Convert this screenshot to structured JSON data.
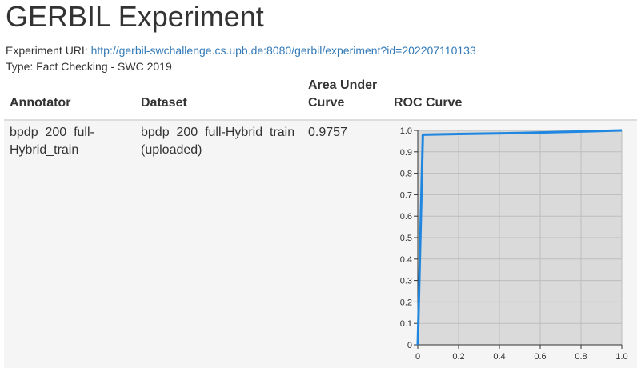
{
  "page": {
    "title": "GERBIL Experiment",
    "uri_label": "Experiment URI:",
    "uri_link": "http://gerbil-swchallenge.cs.upb.de:8080/gerbil/experiment?id=202207110133",
    "type_text": "Type: Fact Checking - SWC 2019"
  },
  "table": {
    "headers": {
      "annotator": "Annotator",
      "dataset": "Dataset",
      "auc_line1": "Area Under",
      "auc_line2": "Curve",
      "roc": "ROC Curve"
    },
    "rows": [
      {
        "annotator": "bpdp_200_full-Hybrid_train",
        "dataset": "bpdp_200_full-Hybrid_train (uploaded)",
        "auc": "0.9757"
      }
    ]
  },
  "chart_data": {
    "type": "line",
    "title": "",
    "xlabel": "",
    "ylabel": "",
    "xlim": [
      0,
      1.0
    ],
    "ylim": [
      0,
      1.0
    ],
    "x_ticks": [
      "0",
      "0.2",
      "0.4",
      "0.6",
      "0.8",
      "1.0"
    ],
    "y_ticks": [
      "0",
      "0.1",
      "0.2",
      "0.3",
      "0.4",
      "0.5",
      "0.6",
      "0.7",
      "0.8",
      "0.9",
      "1.0"
    ],
    "grid": true,
    "series": [
      {
        "x": [
          0,
          0.025,
          0.2,
          0.5,
          0.8,
          1.0
        ],
        "y": [
          0,
          0.98,
          0.983,
          0.988,
          0.995,
          1.0
        ],
        "color": "#1f87e0"
      }
    ],
    "plot_background": "#dadada"
  }
}
